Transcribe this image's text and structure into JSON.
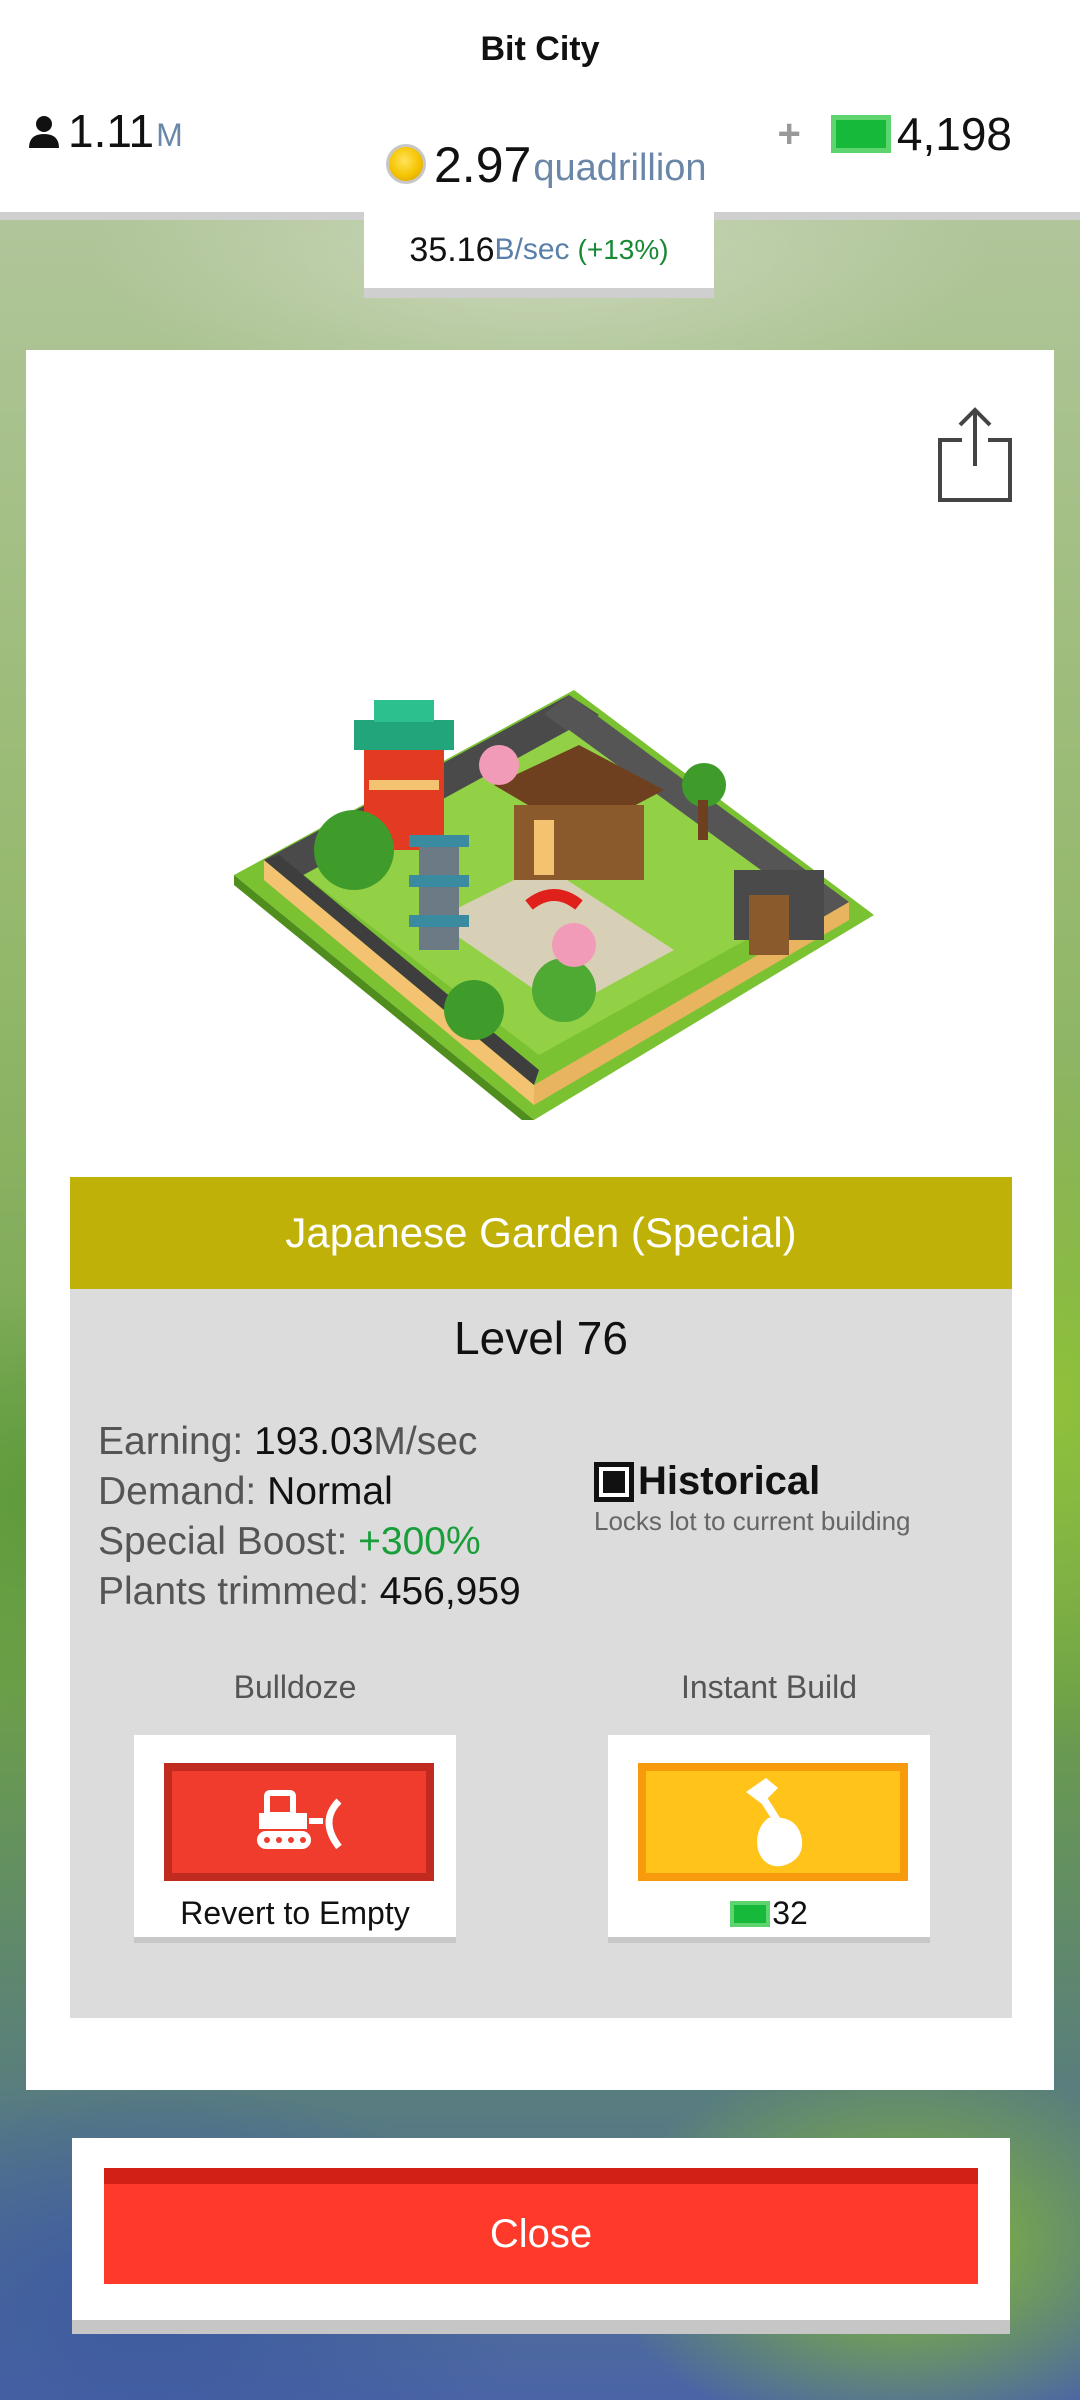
{
  "header": {
    "title": "Bit City",
    "population": {
      "value": "1.11",
      "unit": "M"
    },
    "money": {
      "value": "2.97",
      "unit": "quadrillion"
    },
    "cash": {
      "plus": "+",
      "value": "4,198"
    },
    "income": {
      "value": "35.16",
      "unit": "B/sec",
      "boost": "(+13%)"
    }
  },
  "building": {
    "name": "Japanese Garden (Special)",
    "level": "Level 76",
    "stats": {
      "earning_label": "Earning: ",
      "earning_value": "193.03",
      "earning_unit": "M/sec",
      "demand_label": "Demand: ",
      "demand_value": "Normal",
      "boost_label": "Special Boost: ",
      "boost_value": "+300%",
      "plants_label": "Plants trimmed: ",
      "plants_value": "456,959"
    },
    "historical": {
      "label": "Historical",
      "description": "Locks lot to current building",
      "checked": true
    }
  },
  "actions": {
    "bulldoze": {
      "title": "Bulldoze",
      "text": "Revert to Empty"
    },
    "instant_build": {
      "title": "Instant Build",
      "cost": "32"
    }
  },
  "close_label": "Close",
  "colors": {
    "banner": "#bfb107",
    "bulldoze": "#f03c2d",
    "instant": "#ffc319",
    "close": "#ff3a2b",
    "cash": "#16b93a",
    "boost_green": "#1a9e3a"
  },
  "icons": [
    "person-icon",
    "coin-icon",
    "cash-icon",
    "share-icon",
    "bulldozer-icon",
    "hammer-icon"
  ]
}
